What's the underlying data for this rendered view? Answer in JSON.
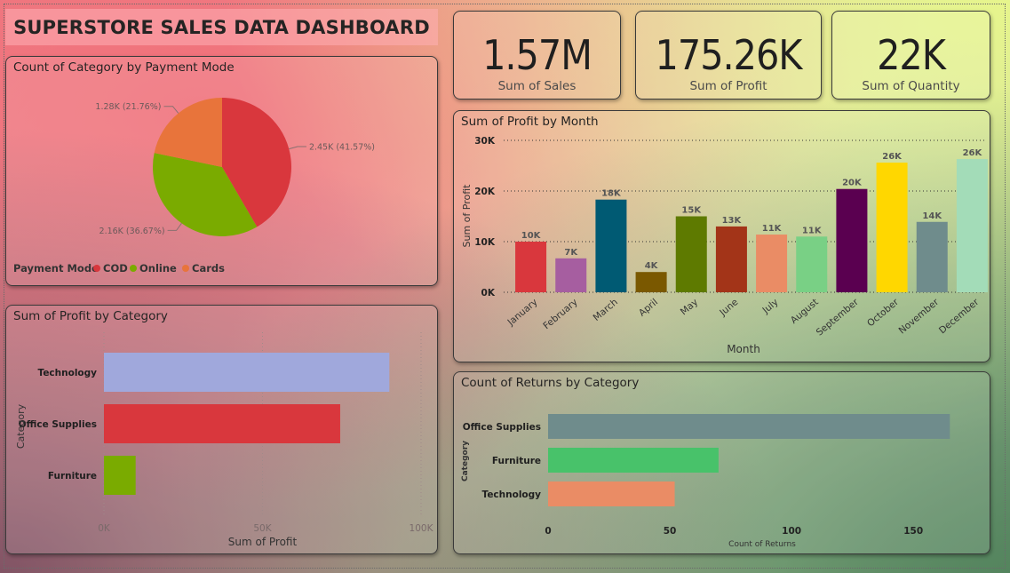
{
  "dashboard": {
    "title": "SUPERSTORE SALES DATA DASHBOARD"
  },
  "kpis": [
    {
      "value": "1.57M",
      "label": "Sum of Sales"
    },
    {
      "value": "175.26K",
      "label": "Sum of Profit"
    },
    {
      "value": "22K",
      "label": "Sum of Quantity"
    }
  ],
  "chart_data": [
    {
      "id": "payment",
      "type": "pie",
      "title": "Count of Category by Payment Mode",
      "legend_title": "Payment Mode",
      "legend_position": "bottom-left",
      "slices": [
        {
          "name": "COD",
          "value": 2450,
          "percent": 41.57,
          "label": "2.45K (41.57%)",
          "color": "#d9373d"
        },
        {
          "name": "Online",
          "value": 2160,
          "percent": 36.67,
          "label": "2.16K (36.67%)",
          "color": "#7aab00"
        },
        {
          "name": "Cards",
          "value": 1280,
          "percent": 21.76,
          "label": "1.28K (21.76%)",
          "color": "#e8743b"
        }
      ]
    },
    {
      "id": "profit_category",
      "type": "bar",
      "orientation": "horizontal",
      "title": "Sum of Profit by Category",
      "xlabel": "Sum of Profit",
      "ylabel": "Category",
      "xlim": [
        0,
        100000
      ],
      "x_ticks": [
        "0K",
        "50K",
        "100K"
      ],
      "grid": true,
      "categories": [
        "Technology",
        "Office Supplies",
        "Furniture"
      ],
      "values": [
        90000,
        74500,
        10000
      ],
      "colors": [
        "#a0a8dc",
        "#d9373d",
        "#7aab00"
      ]
    },
    {
      "id": "profit_month",
      "type": "bar",
      "orientation": "vertical",
      "title": "Sum of Profit by Month",
      "xlabel": "Month",
      "ylabel": "Sum of Profit",
      "ylim": [
        0,
        30000
      ],
      "y_ticks": [
        "0K",
        "10K",
        "20K",
        "30K"
      ],
      "grid": true,
      "categories": [
        "January",
        "February",
        "March",
        "April",
        "May",
        "June",
        "July",
        "August",
        "September",
        "October",
        "November",
        "December"
      ],
      "values": [
        10000,
        6700,
        18300,
        4000,
        15000,
        13000,
        11400,
        11000,
        20400,
        25600,
        13900,
        26300
      ],
      "data_labels": [
        "10K",
        "7K",
        "18K",
        "4K",
        "15K",
        "13K",
        "11K",
        "11K",
        "20K",
        "26K",
        "14K",
        "26K"
      ],
      "colors": [
        "#d9373d",
        "#a65ea0",
        "#005a73",
        "#7a5800",
        "#5e7a00",
        "#a33418",
        "#ea8c65",
        "#79d085",
        "#5a0050",
        "#ffd700",
        "#6f8c8c",
        "#a3dcb8"
      ]
    },
    {
      "id": "returns_category",
      "type": "bar",
      "orientation": "horizontal",
      "title": "Count of Returns by Category",
      "xlabel": "Count of Returns",
      "ylabel": "Category",
      "xlim": [
        0,
        170
      ],
      "x_ticks": [
        "0",
        "50",
        "100",
        "150"
      ],
      "grid": false,
      "categories": [
        "Office Supplies",
        "Furniture",
        "Technology"
      ],
      "values": [
        165,
        70,
        52
      ],
      "colors": [
        "#6f8c8c",
        "#48c26a",
        "#ea8c65"
      ]
    }
  ]
}
